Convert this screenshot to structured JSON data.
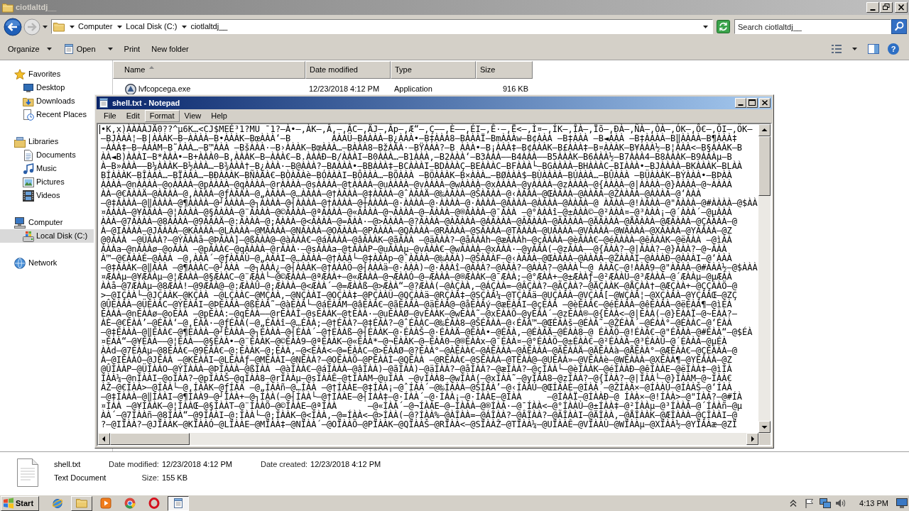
{
  "explorer": {
    "title": "ciotlaltdj__",
    "breadcrumbs": [
      "Computer",
      "Local Disk (C:)",
      "ciotlaltdj__"
    ],
    "search": {
      "placeholder": "Search ciotlaltdj__"
    },
    "toolbar": [
      {
        "label": "Organize",
        "kind": "menu"
      },
      {
        "label": "Open",
        "kind": "split"
      },
      {
        "label": "Print",
        "kind": "plain"
      },
      {
        "label": "New folder",
        "kind": "plain"
      }
    ],
    "help": "?",
    "navigation": [
      {
        "label": "Favorites",
        "kind": "star",
        "selected": false,
        "children": [
          {
            "label": "Desktop",
            "kind": "desktop",
            "selected": false
          },
          {
            "label": "Downloads",
            "kind": "downloads",
            "selected": false
          },
          {
            "label": "Recent Places",
            "kind": "recent",
            "selected": false
          }
        ]
      },
      {
        "label": "Libraries",
        "kind": "library",
        "selected": false,
        "children": [
          {
            "label": "Documents",
            "kind": "documents",
            "selected": false
          },
          {
            "label": "Music",
            "kind": "music",
            "selected": false
          },
          {
            "label": "Pictures",
            "kind": "pictures",
            "selected": false
          },
          {
            "label": "Videos",
            "kind": "videos",
            "selected": false
          }
        ]
      },
      {
        "label": "Computer",
        "kind": "computer",
        "selected": false,
        "children": [
          {
            "label": "Local Disk (C:)",
            "kind": "disk",
            "selected": true
          }
        ]
      },
      {
        "label": "Network",
        "kind": "globe",
        "selected": false
      }
    ],
    "columns": [
      {
        "label": "Name",
        "sorted": true
      },
      {
        "label": "Date modified",
        "sorted": false
      },
      {
        "label": "Type",
        "sorted": false
      },
      {
        "label": "Size",
        "sorted": false
      }
    ],
    "files": [
      {
        "name": "lvfcopcega.exe",
        "date_modified": "12/23/2018 4:12 PM",
        "type": "Application",
        "size": "916 KB"
      }
    ],
    "details": {
      "name": "shell.txt",
      "type": "Text Document",
      "properties": [
        {
          "label": "Date modified:",
          "value": "12/23/2018 4:12 PM"
        },
        {
          "label": "Size:",
          "value": "155 KB"
        },
        {
          "label": "Date created:",
          "value": "12/23/2018 4:12 PM"
        }
      ]
    }
  },
  "notepad": {
    "title": "shell.txt - Notepad",
    "menu": [
      {
        "label": "File",
        "selected": false
      },
      {
        "label": "Edit",
        "selected": false
      },
      {
        "label": "Format",
        "selected": true
      },
      {
        "label": "View",
        "selected": false
      },
      {
        "label": "Help",
        "selected": false
      }
    ],
    "lines": [
      "•K,x)ÀÀÀÀJÄ0??^µ6K…<CJ$MEÉ³1?MU ¯1?–À•–,ÀK–,Â,–,ÂC–,ÄJ–,Âp–,Æ“–,Ç––,È—–,ÉI–,Ê·–,Ë<–,Ì¤–,ÍK–,ÎÀ–,Ïõ–,ÐÀ–,ÑÀ–,ÒÀ–,ÓK–,Ô€–,ÕI–,ÖK–",
      "–BJÀÀÀ¦–B|ÀÀÀK–B–ÀÀÀÀ–B•ÀÀÀK–BœÀÀÀ‘–B        ÀÀÀÜ–BÀÀÀÀ–B¿ÀÀÀ•–B‡ÀÀÀ8–BÀÀÀÏ–BmÀÀÀw–B¢ÀÀÀ –B‡ÀÀÀ –B◄ÀÀÀ –B‡ÀÀÀÀ–B‖ÀÀÀÀ–B¶ÀÀÀ‡",
      "–ÀÀÀ‡–B–ÀÀÀM–B˜ÀÀÀ…–B™ÀÀÀ –BšÀÀÀ·–B›ÀÀÀK–BœÀÀÀ…–BÀÀÀ8–BžÀÀÀ·–BŸÀÀÀ?–B ÀÀÀ•–B¡ÀÀÀ‡–B¢ÀÀÀK–B£ÀÀÀ‡–B¤ÀÀÀK–B¥ÀÀÀ½–B¦ÀÀÀ<–B§ÀÀÀK–B",
      "ÀÀ◄B)ÀÀÀI–B*ÀÀÀ•–B+ÀÀÀ0–B,ÀÀÀK–B–ÀÀÀ€–B.ÀÀÀÐ–B/ÀÀÀI–B0ÀÀÀ…–B1ÀÀÀ,–B2ÀÀÀ‘–B3ÀÀÀ––B4ÀÀÀ—–B5ÀÀÀK–B6ÀÀÀ½–B7ÀÀÀ4–B8ÀÀÀK–B9ÀÀÀµ–B",
      "À–B»ÀÀÀ––B¼ÀÀÀK–B½ÀÀÀ…–B¾ÀÀÀ†–B¿ÀÀÀ·–B@ÀÀÀ?–BAÀÀÀ•–BBÀÀÀ‡–BCÀÀÀI–BDÀÀÀÇ–BEÀÀÀC–BFÀÀÀ└–BGÀÀÀÀ–BHÀÀÀC–BIÀÀÀ•–BJÀÀÀÀ–BKÀÀÀK–BLÀÀ",
      "BÍÀÀÀK–BÎÀÀÀ…–BÏÀÀÀ…–BÐÀÀÀK–BÑÀÀÀ€–BÒÀÀÀè–BÓÀÀÀI–BÔÀÀÀ…–BÕÀÀÀ –BÖÀÀÀK–B×ÀÀÀ…–BØÀÀÀ$–BÙÀÀÀÀ–BÚÀÀÀ…–BÛÀÀÀ –BÜÀÀÀK–BÝÀÀÀ•–BÞÀÀ",
      "ÀÀÀÀ–@nÀÀÀÀ–@oÀÀÀÀ–@pÀÀÀÀ–@qÀÀÀÀ–@rÀÀÀÀ–@sÀÀÀÀ–@tÀÀÀÀ–@uÀÀÀÀ–@vÀÀÀÀ–@wÀÀÀÀ–@xÀÀÀÀ–@yÀÀÀÀ–@zÀÀÀÀ–@{ÀÀÀÀ–@|ÀÀÀÀ–@}ÀÀÀÀ–@~ÀÀÀÀ",
      "ÀÀ–@€ÀÀÀÄ–@ÀÀÀÀ–@‚ÀÀÀÀ–@ƒÀÀÀÀ–@„ÀÀÀÀ–@…ÀÀÀÀ–@†ÀÀÀÀ–@‡ÀÀÀÀ–@ˆÀÀÀÄ–@‰ÀÀÀÀ–@ŠÀÀÀÀ–@‹ÀÀÀÀ–@ŒÀÀÀÀ–@ÀÀÀÀ–@ŽÀÀÀÀ–@ÀÀÀÀ–@‘ÀÀÀ",
      "–@‡ÀÀÀÀ–@‖ÀÀÀÀ–@¶ÀÀÀÀ–@┘ÀÀÀÀ–@┐ÀÀÀÀ–@┤ÀÀÀÀ–@†ÀÀÀÀ–@┼ÀÀÀÀ–@·ÀÀÀÀ–@·ÀÀÀÀ–@·ÀÀÀÀ–@ÀÀÀÀ–@ÀÀÀÀ–@ÀÀÀÀ–@ ÀÀÀÀ–@!ÀÀÀÀ–@\"ÀÀÀÀ–@#ÀÀÀÀ–@$ÀÀ",
      "¤ÀÀÀÀ–@¥ÀÀÀÀ–@¦ÀÀÀÀ–@§ÀÀÀÀ–@¨ÀÀÀÀ–@©ÀÀÀÀ–@ªÀÀÀÀ–@«ÀÀÀÀ–@¬ÀÀÀÀ–@–ÀÀÀÀ–@®ÀÀÀÀ–@¯ÀÀÀ –@°ÀÀÀî–@±ÀÀÀ©–@²ÀÀÀ¤–@³ÀÀÀ¡–@´ÀÀÀ´–@µÀÀÀ",
      "ÀÀÀ–@7ÀÀÀÀ–@8ÀÀÀÀ–@9ÀÀÀÄ–@:ÀÀÀÀ–@;ÀÀÀÀ–@<ÀÀÀÀ–@=ÀÀÀ·–@>ÀÀÀÀ–@?ÀÀÀÀ–@ÀÀÀÀÀ–@ÁÀÀÀÀ–@ÂÀÀÀÀ–@ÃÀÀÀÀ–@ÄÀÀÀÀ–@ÅÀÀÀÀ–@ÆÀÀÀÀ–@ÇÀÀÀÀ–@",
      "À–@IÀÀÀÀ–@JÀÀÀÀ–@KÀÀÀÀ–@LÀÀÀÀ–@MÀÀÀÀ–@NÀÀÀÀ–@OÀÀÀÀ–@PÀÀÀÀ–@QÀÀÀÀ–@RÀÀÀÀ–@SÀÀÀÀ–@TÀÀÀÀ–@UÀÀÀÀ–@VÀÀÀÀ–@WÀÀÀÀ–@XÀÀÀÀ–@YÀÀÀÀ–@Z",
      "@0ÀÀÀ –@ÜÀÀÀ?–@ÝÀÀÀå–@ÞÀÀÀ]–@ßÀÀÀ@–@àÀÀÀ€–@áÀÀÀÀ–@âÀÀÀK–@ãÀÀÀ –@äÀÀÀ?–@åÀÀÀh–@æÀÀÀh–@çÀÀÀÀ–@èÀÀÀ€–@éÀÀÀÀ–@êÀÀÀK–@ëÀÀÀ –@ìÀÀ",
      "ÀÀÀa–@nÀÀÀø–@oÀÀÀ –@pÀÀÀ€–@qÀÀÀÀ–@rÀÀÀ·–@sÀÀÀa–@tÀÀÀP–@uÀÀÀµ–@vÀÀÀ€–@wÀÀÀÀ–@xÀÀÀ·–@yÀÀÀ(–@zÀÀÀ––@{ÀÀÀ?–@|ÀÀÀ?–@}ÀÀÀ?–@~ÀÀÀ",
      "À™–@€ÀÀÀÉ–@ÀÀÀ –@‚ÀÀÀ´–@ƒÀÀÀÙ–@„ÀÀÀI–@…ÀÀÀÀ–@†ÀÀÀ└–@‡ÀÀÀp–@ˆÀÀÀÀ–@‰ÀÀÀ)–@ŠÀÀÀF–@‹ÀÀÀÀ–@ŒÀÀÀÀ–@ÀÀÀÀ–@ŽÀÀÀI–@ÀÀÀÐ–@ÀÀÀI–@‘ÀÀÀ",
      "–@‡ÀÀÀK–@‖ÀÀÀ –@¶ÀÀÀC–@┘ÀÀÀ –@┐ÀÀÀ¿–@┤ÀÀÀK–@†ÀÀÀÖ–@┤ÀÀÀä–@·ÀÀÀ)–@·ÀÀÀî–@ÀÀÀ?–@ÀÀÀ?–@ÀÀÀ?–@ÀÀÀ└–@ ÀÀÀC–@!ÀÀÀ9–@\"ÀÀÀÀ–@#ÀÀÀ½–@$ÀÀÀ",
      "¤ÆÀÀµ–@¥ÆÀÀµ–@¦ÆÀÀÀ–@§ÆÀÀC–@¨ÆÀÀ└–@©ÆÀÀÀ–@ªÆÀÀ+–@«ÆÀÀÀ–@¬ÆÀÀÓ–@–ÆÀÀÀ–@®ÆÀÀK–@¯ÆÀÀ;–@°ÆÀÀ+–@±ÆÀÀƒ–@²ÆÀÀÜ–@³ÆÀÀÀ–@´ÆÀÀµ–@µÆÀÀ",
      "ÀÀå–@7ÆÀÀµ–@8ÆÀÀ!–@9ÆÀÀ@–@:ÆÀÀÛ–@;ÆÀÀÀ–@<ÆÀÀ´–@=ÆÀÀß–@>ÆÀÀ“–@?ÆÀÀ(–@ÀÇÀÀ,–@ÁÇÀÀ=–@ÂÇÀÀ?–@ÃÇÀÀ?–@ÄÇÀÀK–@ÅÇÀÀ†–@ÆÇÀÀ+–@ÇÇÀÀÕ–@",
      ">–@IÇÀÀ└–@JÇÀÀK–@KÇÀÀ –@LÇÀÀC–@MÇÀÀ,–@NÇÀÀI–@OÇÀÀ‡–@PÇÀÀÜ–@QÇÀÀä–@RÇÀÀ‡–@SÇÀÀ¼–@TÇÀÀä–@UÇÀÀÀ–@VÇÀÀ[–@WÇÀÀ¦–@XÇÀÀÀ–@YÇÀÀŒ–@ZÇ",
      "@ÛÈÀÀÀ–@ÜÈÀÀC–@ÝÈÀÀI–@ÞÈÀÀÀ–@ßÈÀÀ˜–@àÈÀÀ└–@áÈÀÀM–@âÈÀÀ€–@ãÈÀÀÀ–@äÈÀÀ@–@åÈÀÀý–@æÈÀÀI–@çÈÀÀ –@èÈÀÀ€–@éÈÀÀÀ–@êÈÀÀÀ–@ëÈÀÀ¶–@ìÈÀ",
      "ÈÀÀÀ–@nÈÀÀø–@oÈÀÀ –@pÈÀÀ:–@qÈÀÀ––@rÈÀÀÎ–@sÈÀÀK–@tÈÀÀ·–@uÈÀÀØ–@vÈÀÀK–@wÈÀÀ˜–@xÈÀÀÕ–@yÈÀÀ´–@zÈÀÀ®–@{ÈÀÀ<–@|ÈÀÀ(–@}ÈÀÀÏ–@~ÈÀÀ?–",
      "ÀÈ–@€ÉÀÀ’–@ÉÀÀ‘–@‚ÉÀÀ·–@ƒÉÀÀ(–@„ÉÀÀî–@…ÉÀÀ;–@†ÉÀÀ?–@‡ÉÀÀ?–@ˆÉÀÀC–@‰ÉÀÀ8–@ŠÉÀÀÀ–@‹ÉÀÀ™–@ŒÉÀÀš–@ÉÀÀ˜–@ŽÉÀÀ´–@ÉÀÀ°–@ÉÀÀC–@‘ÉÀÀ",
      "–@‡ÉÀÀÀ–@‖ÉÀÀ€–@¶ÉÀÀÀ–@┘ÉÀÀÀ–@┐ÉÀÀÀ–@┤ÉÀÀ´–@†ÉÀÀß–@┤ÉÀÀK–@·ÉÀÀŠ–@·ÉÀÀÄ–@ÉÀÀ•–@ÉÀÀ,–@ÉÀÀÄ–@ÉÀÀ8–@ ÉÀÀÖ–@!ÉÀÀ€–@\"ÉÀÀÀ–@#ÉÀÀ“–@$ÉÀ",
      "¤ÉÀÀ“–@¥ÉÀÀ––@¦ÉÀÀ––@§ÉÀÀ•–@¨ÉÀÀK–@©ÉÀÀ9–@ªÉÀÀK–@«ÉÀÀ*–@¬ÉÀÀK–@–ÉÀÀ0–@®ÉÀÀx–@¯ÉÀÀ¤–@°ÉÀÀÖ–@±ÉÀÀ€–@²ÉÀÀÀ–@³ÉÀÀÛ–@´ÉÀÀÀ–@µÉÀ",
      "ÀÀd–@7ÉÀÀµ–@8ÉÀÀ€–@9ÉÀÀ€–@:ÉÀÀK–@;ÉÀÀ,–@<ÉÀÀ<–@=ÉÀÀC–@>ÉÀÀØ–@?ÉÀÀ°–@ÀÊÀÀ€–@ÁÊÀÀÀ–@ÂÊÀÀÀ–@ÃÊÀÀÄ–@ÄÊÀÀà–@ÅÊÀÀ°–@ÆÊÀÀ€–@ÇÊÀÀÀ–@",
      "À–@IÊÀÀÓ–@JÊÀÀ –@KÊÀÀI–@LÊÀÀƒ–@MÊÀÀI–@NÊÀÀ?–@OÊÀÀÕ–@PÊÀÀÌ–@QÊÀÀ –@RÊÀÀ€–@SÊÀÀÀ–@TÊÀÀ@–@UÊÀÀ»–@VÊÀÀè–@WÊÀÀÀ–@XÊÀÀ¶–@YÊÀÀÀ–@Z",
      "@ÛÌÀÀP–@ÜÌÀÀO–@ÝÌÀÀÀ–@ÞÌÀÀÀ–@ßÌÀÀ –@àÌÀÀ€–@áÌÀÀÀ–@âÌÀÀ)–@ãÌÀÀ)–@äÌÀÀ?–@åÌÀÀ?–@æÌÀÀ?–@çÌÀÀ└–@èÌÀÀK–@éÌÀÀÐ–@êÌÀÀE–@ëÌÀÀ‡–@ìÌÀ",
      "ÌÀÀ¼–@nÌÀÀI–@oÌÀÀ?–@pÌÀÀŠ–@qÌÀÀ8–@rÌÀÀµ–@sÌÀÀÊ–@tÌÀÀM–@uÌÀÀ –@vÌÀÀ8–@wÌÀÀ(–@xÌÀÀ˜–@yÌÀÀ8–@zÌÀÀ?–@{ÌÀÀ?–@|ÌÀÀ└–@}ÌÀÀM–@~ÌÀÀ€",
      "ÀŽ–@€ÍÀÀ>–@ÍÀÀ└–@‚ÍÀÀK–@ƒÍÀÀ –@„ÍÀÀñ–@…ÍÀÀ –@†ÍÀÀE–@‡ÍÀÀ¡–@ˆÍÀÀ´–@‰ÍÀÀÀ–@ŠÍÀÀ’–@‹ÍÀÀÚ–@ŒÍÀÀÈ–@ÍÀÀ´–@ŽÍÀÀ×–@ÍÀÀÚ–@ÍÀÀŠ–@‘ÍÀÀ",
      "–@‡ÍÀÀÀ–@‖ÍÀÀI–@¶ÍÀÀ9–@┘ÍÀÀ+–@┐ÍÀÀ(–@┤ÍÀÀ└–@†ÍÀÀE–@┤ÍÀÀ‡–@·ÍÀÀ´–@·ÍÀÀ¡–@·ÍÀÀE–@ÍÀÀ     –@ÍÀÀÏ–@ÍÀÀÐ–@ ÍÀÀ×–@!ÍÀÀ>–@\"ÍÀÀ?–@#ÍÀ",
      "¤ÍÀÀ –@¥ÍÀÀK–@¦ÍÀÀŒ–@§ÍÀÀT–@¨ÍÀÀÕ–@©ÍÀÀE–@ªÍÀÀ      –@«ÍÀÀ´–@¬ÍÀÀE–@–ÍÀÀÀ–@®ÍÀÀ·–@¯ÍÀÀ<–@°ÍÀÀÙ–@±ÍÀÀ‡–@²ÍÀÀµ–@³ÍÀÀÀ–@´ÍÀÀñ–@µ",
      "ÀÀ´–@7ÍÀÀñ–@8ÍÀÀ“–@9ÍÀÀI–@:ÍÀÀ└–@;ÍÀÀK–@<ÍÀÀ,–@=ÍÀÀ<–@>ÍÀÀ(–@?ÍÀÀ%–@ÀÎÀÀ=–@ÁÎÀÀ?–@ÂÎÀÀ?–@ÃÎÀÀI–@ÄÎÀÀ,–@ÅÎÀÀK–@ÆÎÀÀÀ–@ÇÎÀÀI–@",
      "?–@IÏÀÀ?–@JÏÀÀK–@KÏÀÀÓ–@LÏÀÀE–@MÏÀÀ‡–@NÏÀÀ´–@OÏÀÀÕ–@PÏÀÀK–@QÏÀÀŠ–@RÏÀÀ<–@SÏÀÀŽ–@TÏÀÀ¼–@UÏÀÀÊ–@VÏÀÀÙ–@WÏÀÀµ–@XÏÀÀ½–@YÏÀÀæ–@ZÏ"
    ]
  },
  "taskbar": {
    "start": "Start",
    "apps": [
      {
        "kind": "globe",
        "open": false,
        "selected": false
      },
      {
        "kind": "folder",
        "open": true,
        "selected": false
      },
      {
        "kind": "media",
        "open": false,
        "selected": false
      },
      {
        "kind": "wheel",
        "open": false,
        "selected": false
      },
      {
        "kind": "ring",
        "open": false,
        "selected": false
      },
      {
        "kind": "notepad",
        "open": true,
        "selected": true
      }
    ],
    "clock": "4:13 PM"
  }
}
